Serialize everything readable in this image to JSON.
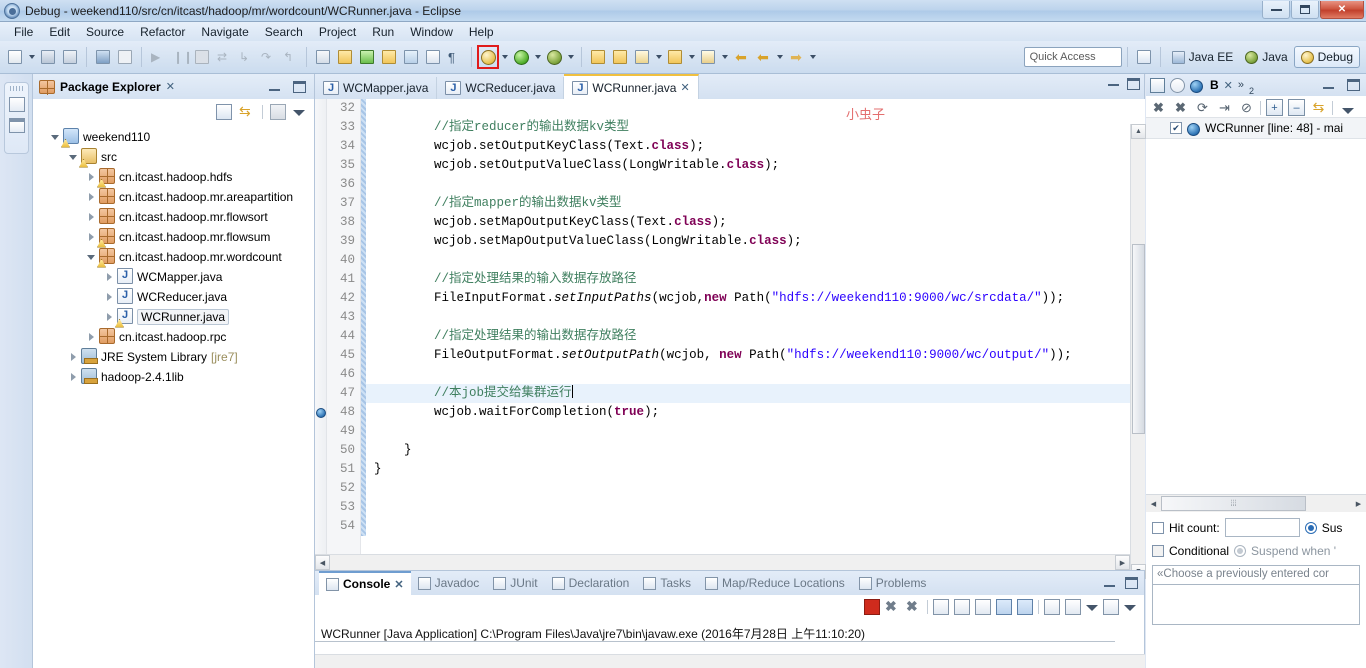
{
  "window": {
    "title": "Debug - weekend110/src/cn/itcast/hadoop/mr/wordcount/WCRunner.java - Eclipse",
    "minimize": "–",
    "maximize": "❐",
    "close": "✕"
  },
  "menu": {
    "items": [
      "File",
      "Edit",
      "Source",
      "Refactor",
      "Navigate",
      "Search",
      "Project",
      "Run",
      "Window",
      "Help"
    ]
  },
  "toolbar": {
    "quick_access": "Quick Access",
    "perspectives": [
      {
        "label": "Java EE",
        "active": false
      },
      {
        "label": "Java",
        "active": false
      },
      {
        "label": "Debug",
        "active": true
      }
    ]
  },
  "package_explorer": {
    "title": "Package Explorer",
    "tree": [
      {
        "label": "weekend110",
        "depth": 0,
        "twisty": "open",
        "icon": "project-icon",
        "warn": true
      },
      {
        "label": "src",
        "depth": 1,
        "twisty": "open",
        "icon": "source-folder-icon",
        "warn": true
      },
      {
        "label": "cn.itcast.hadoop.hdfs",
        "depth": 2,
        "twisty": "closed",
        "icon": "package-icon",
        "warn": true
      },
      {
        "label": "cn.itcast.hadoop.mr.areapartition",
        "depth": 2,
        "twisty": "closed",
        "icon": "package-icon",
        "warn": false
      },
      {
        "label": "cn.itcast.hadoop.mr.flowsort",
        "depth": 2,
        "twisty": "closed",
        "icon": "package-icon",
        "warn": false
      },
      {
        "label": "cn.itcast.hadoop.mr.flowsum",
        "depth": 2,
        "twisty": "closed",
        "icon": "package-icon",
        "warn": true
      },
      {
        "label": "cn.itcast.hadoop.mr.wordcount",
        "depth": 2,
        "twisty": "open",
        "icon": "package-icon",
        "warn": true
      },
      {
        "label": "WCMapper.java",
        "depth": 3,
        "twisty": "closed",
        "icon": "java-file-icon",
        "warn": false
      },
      {
        "label": "WCReducer.java",
        "depth": 3,
        "twisty": "closed",
        "icon": "java-file-icon",
        "warn": false
      },
      {
        "label": "WCRunner.java",
        "depth": 3,
        "twisty": "closed",
        "icon": "java-file-icon",
        "warn": true,
        "selected": true
      },
      {
        "label": "cn.itcast.hadoop.rpc",
        "depth": 2,
        "twisty": "closed",
        "icon": "package-icon",
        "warn": false
      },
      {
        "label": "JRE System Library",
        "suffix": "[jre7]",
        "depth": 1,
        "twisty": "closed",
        "icon": "library-icon",
        "warn": false
      },
      {
        "label": "hadoop-2.4.1lib",
        "depth": 1,
        "twisty": "closed",
        "icon": "library-icon",
        "warn": false
      }
    ]
  },
  "editor": {
    "tabs": [
      {
        "label": "WCMapper.java",
        "active": false,
        "closable": false
      },
      {
        "label": "WCReducer.java",
        "active": false,
        "closable": false
      },
      {
        "label": "WCRunner.java",
        "active": true,
        "closable": true
      }
    ],
    "annotation": "小虫子",
    "first_line_number": 32,
    "highlight_line": 47,
    "breakpoint_line": 48,
    "lines": [
      {
        "n": 32,
        "text": ""
      },
      {
        "n": 33,
        "text": "\t\t//指定reducer的输出数据kv类型"
      },
      {
        "n": 34,
        "text": "\t\twcjob.setOutputKeyClass(Text.class);"
      },
      {
        "n": 35,
        "text": "\t\twcjob.setOutputValueClass(LongWritable.class);"
      },
      {
        "n": 36,
        "text": ""
      },
      {
        "n": 37,
        "text": "\t\t//指定mapper的输出数据kv类型"
      },
      {
        "n": 38,
        "text": "\t\twcjob.setMapOutputKeyClass(Text.class);"
      },
      {
        "n": 39,
        "text": "\t\twcjob.setMapOutputValueClass(LongWritable.class);"
      },
      {
        "n": 40,
        "text": ""
      },
      {
        "n": 41,
        "text": "\t\t//指定处理结果的输入数据存放路径"
      },
      {
        "n": 42,
        "text": "\t\tFileInputFormat.setInputPaths(wcjob,new Path(\"hdfs://weekend110:9000/wc/srcdata/\"));"
      },
      {
        "n": 43,
        "text": ""
      },
      {
        "n": 44,
        "text": "\t\t//指定处理结果的输出数据存放路径"
      },
      {
        "n": 45,
        "text": "\t\tFileOutputFormat.setOutputPath(wcjob, new Path(\"hdfs://weekend110:9000/wc/output/\"));"
      },
      {
        "n": 46,
        "text": ""
      },
      {
        "n": 47,
        "text": "\t\t//本job提交给集群运行"
      },
      {
        "n": 48,
        "text": "\t\twcjob.waitForCompletion(true);"
      },
      {
        "n": 49,
        "text": ""
      },
      {
        "n": 50,
        "text": "\t}"
      },
      {
        "n": 51,
        "text": "}"
      },
      {
        "n": 52,
        "text": ""
      },
      {
        "n": 53,
        "text": ""
      },
      {
        "n": 54,
        "text": ""
      }
    ]
  },
  "console": {
    "tabs": [
      {
        "label": "Console",
        "active": true,
        "closable": true
      },
      {
        "label": "Javadoc",
        "active": false
      },
      {
        "label": "JUnit",
        "active": false
      },
      {
        "label": "Declaration",
        "active": false
      },
      {
        "label": "Tasks",
        "active": false
      },
      {
        "label": "Map/Reduce Locations",
        "active": false
      },
      {
        "label": "Problems",
        "active": false
      }
    ],
    "launch_line": "WCRunner [Java Application] C:\\Program Files\\Java\\jre7\\bin\\javaw.exe (2016年7月28日 上午11:10:20)"
  },
  "debug_panel": {
    "tab_label": "B",
    "overflow_count": "2",
    "breakpoint": {
      "label": "WCRunner [line: 48] - mai",
      "checked": true
    },
    "form": {
      "hit_count_label": "Hit count:",
      "hit_count_value": "",
      "suspend_policy_label": "Sus",
      "conditional_label": "Conditional",
      "suspend_when_label": "Suspend when '",
      "condition_placeholder": "«Choose a previously entered cor"
    }
  }
}
